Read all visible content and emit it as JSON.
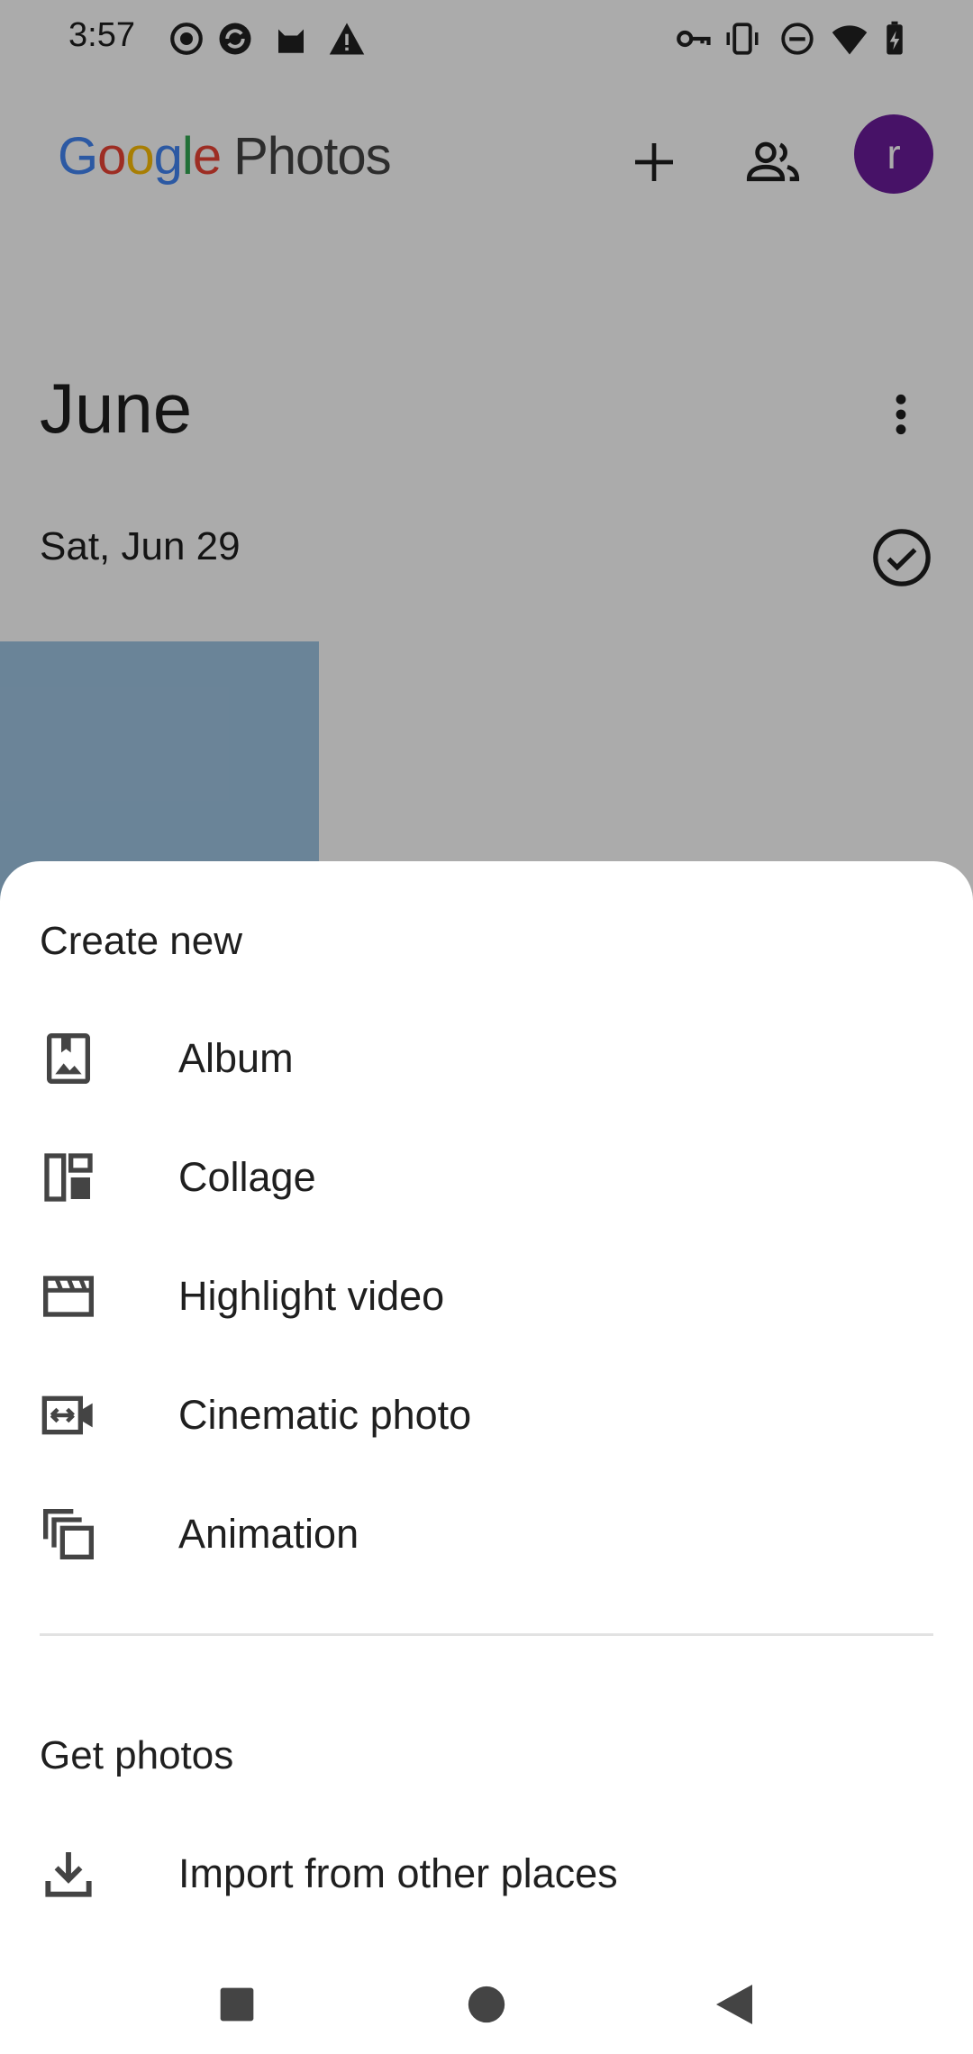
{
  "status_bar": {
    "time": "3:57",
    "left_icons": [
      "record-icon",
      "sync-icon",
      "cat-icon",
      "warning-icon"
    ],
    "right_icons": [
      "vpn-key-icon",
      "vibrate-icon",
      "do-not-disturb-icon",
      "wifi-icon",
      "battery-charging-icon"
    ]
  },
  "app_bar": {
    "logo_letters": [
      "G",
      "o",
      "o",
      "g",
      "l",
      "e"
    ],
    "logo_product": "Photos",
    "add_icon": "plus-icon",
    "sharing_icon": "people-icon",
    "avatar_letter": "r",
    "avatar_color": "#6a1b9a"
  },
  "timeline": {
    "month": "June",
    "date_header": "Sat, Jun 29"
  },
  "sheet": {
    "create_title": "Create new",
    "create_items": [
      {
        "label": "Album",
        "icon": "album-icon"
      },
      {
        "label": "Collage",
        "icon": "collage-icon"
      },
      {
        "label": "Highlight video",
        "icon": "highlight-video-icon"
      },
      {
        "label": "Cinematic photo",
        "icon": "cinematic-photo-icon"
      },
      {
        "label": "Animation",
        "icon": "animation-icon"
      }
    ],
    "get_title": "Get photos",
    "get_items": [
      {
        "label": "Import from other places",
        "icon": "download-icon"
      }
    ]
  },
  "nav_bar": {
    "recents": "square-icon",
    "home": "circle-icon",
    "back": "triangle-back-icon"
  }
}
